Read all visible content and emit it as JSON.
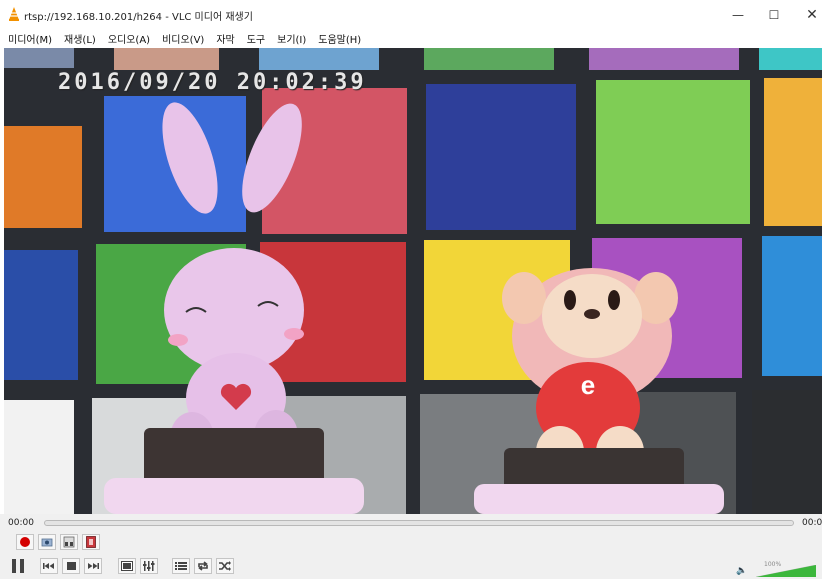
{
  "window": {
    "title": "rtsp://192.168.10.201/h264 - VLC 미디어 재생기",
    "minimize_glyph": "—",
    "maximize_glyph": "☐",
    "close_glyph": "✕"
  },
  "menu": {
    "items": [
      "미디어(M)",
      "재생(L)",
      "오디오(A)",
      "비디오(V)",
      "자막",
      "도구",
      "보기(I)",
      "도움말(H)"
    ]
  },
  "video": {
    "timestamp": "2016/09/20 20:02:39"
  },
  "controls": {
    "time_current": "00:00",
    "time_total": "00:0",
    "seek_position": 0,
    "volume_label": "100%",
    "volume_level": 1.0
  },
  "icons": {
    "title": "vlc-cone-icon",
    "record": "record-icon",
    "snapshot": "snapshot-icon",
    "loop_ab": "loop-ab-icon",
    "frame_step": "frame-step-icon",
    "pause": "pause-icon",
    "prev": "previous-icon",
    "stop": "stop-icon",
    "next": "next-icon",
    "fullscreen": "fullscreen-icon",
    "extended": "extended-settings-icon",
    "playlist": "playlist-icon",
    "loop": "loop-icon",
    "shuffle": "shuffle-icon",
    "volume": "speaker-icon"
  },
  "colors": {
    "vlc_orange": "#f29100",
    "record_red": "#d40000",
    "volume_green": "#3cb73c"
  }
}
